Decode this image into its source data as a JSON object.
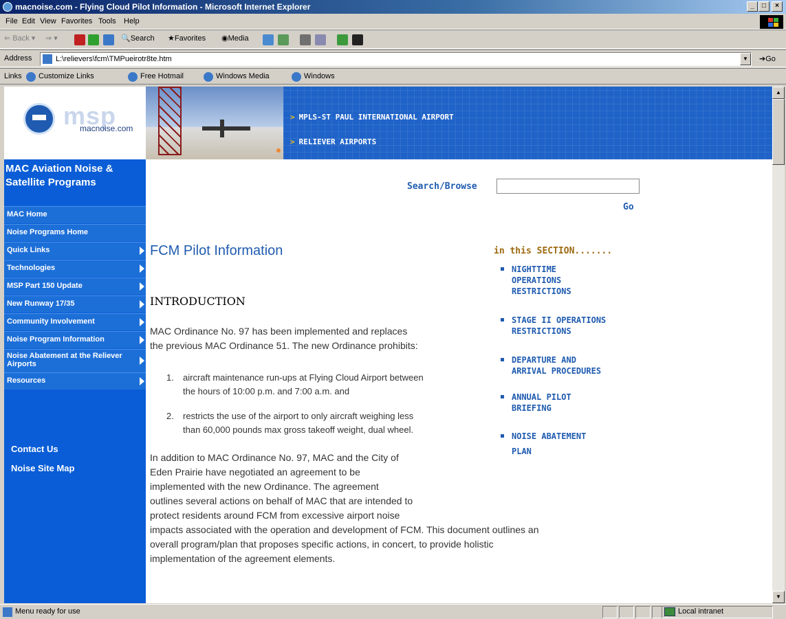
{
  "window": {
    "title": "macnoise.com - Flying Cloud Pilot Information - Microsoft Internet Explorer"
  },
  "menu": [
    "File",
    "Edit",
    "View",
    "Favorites",
    "Tools",
    "Help"
  ],
  "toolbar": {
    "back": "Back",
    "search": "Search",
    "favorites": "Favorites",
    "media": "Media"
  },
  "address": {
    "label": "Address",
    "url": "L:\\relievers\\fcm\\TMPueirotr8te.htm",
    "go": "Go"
  },
  "links": {
    "label": "Links",
    "items": [
      "Customize Links",
      "Free Hotmail",
      "Windows Media",
      "Windows"
    ]
  },
  "site": {
    "logo_text": "msp",
    "logo_site": "macnoise.com",
    "header_links": [
      "MPLS-ST PAUL INTERNATIONAL AIRPORT",
      "RELIEVER AIRPORTS"
    ]
  },
  "nav": {
    "heading": "MAC Aviation Noise & Satellite Programs",
    "items": [
      {
        "label": "MAC Home",
        "arrow": false
      },
      {
        "label": "Noise Programs Home",
        "arrow": false
      },
      {
        "label": "Quick Links",
        "arrow": true
      },
      {
        "label": "Technologies",
        "arrow": true
      },
      {
        "label": "MSP Part 150 Update",
        "arrow": true
      },
      {
        "label": "New Runway 17/35",
        "arrow": true
      },
      {
        "label": "Community Involvement",
        "arrow": true
      },
      {
        "label": "Noise Program Information",
        "arrow": true
      },
      {
        "label": "Noise Abatement at the Reliever Airports",
        "arrow": true
      },
      {
        "label": "Resources",
        "arrow": true
      }
    ],
    "footer": [
      "Contact Us",
      "Noise Site Map"
    ]
  },
  "search": {
    "label": "Search/Browse",
    "value": "",
    "go": "Go"
  },
  "content": {
    "title": "FCM Pilot Information",
    "section": "INTRODUCTION",
    "para1_l1": "MAC Ordinance No. 97 has been implemented and replaces",
    "para1_l2": "the previous MAC Ordinance 51. The new Ordinance prohibits:",
    "list": [
      {
        "num": "1.",
        "l1": "aircraft maintenance run-ups at Flying Cloud Airport between",
        "l2": "the hours of 10:00 p.m. and 7:00 a.m. and"
      },
      {
        "num": "2.",
        "l1": "restricts the use of the airport to only aircraft weighing less",
        "l2": "than 60,000 pounds max gross takeoff weight, dual wheel."
      }
    ],
    "para2": [
      "In addition to MAC Ordinance No. 97, MAC and the City of",
      "Eden Prairie have negotiated an agreement to be",
      "implemented with the new Ordinance. The agreement",
      "outlines several actions on behalf of MAC that are intended to",
      "protect residents around FCM from excessive airport noise",
      "impacts associated with the operation and development of FCM. This document outlines an",
      "overall program/plan that proposes specific actions, in concert, to provide holistic",
      "implementation of the agreement elements."
    ]
  },
  "in_section": {
    "title": "in this SECTION.......",
    "items": [
      {
        "l1": "NIGHTTIME",
        "l2": "OPERATIONS",
        "l3": "RESTRICTIONS"
      },
      {
        "l1": "STAGE II OPERATIONS",
        "l2": "RESTRICTIONS",
        "l3": ""
      },
      {
        "l1": "DEPARTURE AND",
        "l2": "ARRIVAL PROCEDURES",
        "l3": ""
      },
      {
        "l1": "ANNUAL PILOT",
        "l2": "BRIEFING",
        "l3": ""
      },
      {
        "l1": "NOISE ABATEMENT",
        "l2": "PLAN",
        "l3": ""
      }
    ]
  },
  "status": {
    "message": "Menu ready for use",
    "zone": "Local intranet"
  }
}
